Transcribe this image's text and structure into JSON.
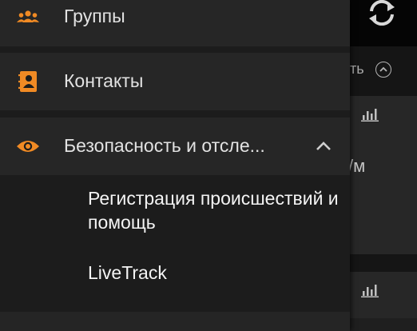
{
  "drawer": {
    "items": [
      {
        "label": "Группы",
        "icon": "groups-icon"
      },
      {
        "label": "Контакты",
        "icon": "contacts-book-icon"
      },
      {
        "label": "Безопасность и отсле...",
        "icon": "eye-icon",
        "expanded": true
      }
    ],
    "sub_items": [
      {
        "label": "Регистрация происшествий и помощь"
      },
      {
        "label": "LiveTrack"
      }
    ]
  },
  "background": {
    "collapse_text": "ть",
    "card_text": "/м"
  },
  "colors": {
    "accent": "#f08a24",
    "drawer_bg": "#1c1c1c",
    "item_bg": "#262626",
    "text": "#e2e2e2"
  }
}
